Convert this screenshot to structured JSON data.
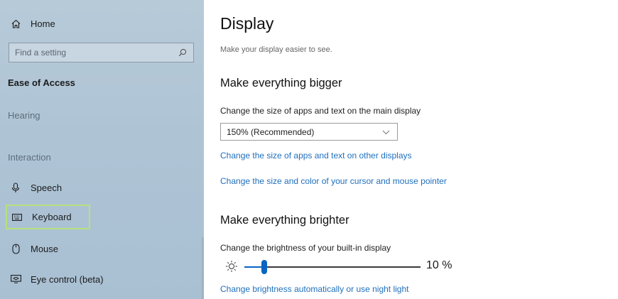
{
  "sidebar": {
    "home_label": "Home",
    "search_placeholder": "Find a setting",
    "section_title": "Ease of Access",
    "hearing_label": "Hearing",
    "group_interaction": "Interaction",
    "items": [
      {
        "label": "Speech",
        "icon": "microphone-icon"
      },
      {
        "label": "Keyboard",
        "icon": "keyboard-icon",
        "selected": true
      },
      {
        "label": "Mouse",
        "icon": "mouse-icon"
      },
      {
        "label": "Eye control (beta)",
        "icon": "eye-control-icon"
      }
    ]
  },
  "main": {
    "title": "Display",
    "subtitle": "Make your display easier to see.",
    "bigger": {
      "heading": "Make everything bigger",
      "scale_label": "Change the size of apps and text on the main display",
      "scale_value": "150% (Recommended)",
      "link_other_displays": "Change the size of apps and text on other displays",
      "link_cursor": "Change the size and color of your cursor and mouse pointer"
    },
    "brighter": {
      "heading": "Make everything brighter",
      "brightness_label": "Change the brightness of your built-in display",
      "brightness_value": 10,
      "brightness_text": "10 %",
      "link_night_light": "Change brightness automatically or use night light"
    }
  },
  "colors": {
    "link": "#1f6fbd",
    "accent": "#0a64c0",
    "selection_outline": "#b6e07d",
    "sidebar_bg": "#aec4d5"
  }
}
